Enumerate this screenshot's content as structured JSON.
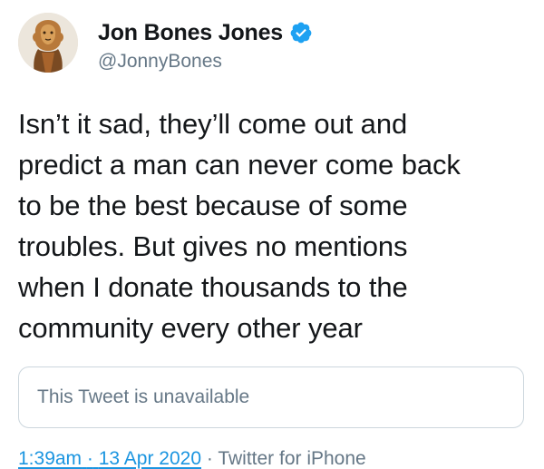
{
  "user": {
    "display_name": "Jon Bones Jones",
    "handle": "@JonnyBones",
    "verified": true
  },
  "tweet": {
    "lines": [
      "Isn’t it sad, they’ll come out and",
      "predict a man can never come back",
      "to be the best because of some",
      "troubles. But gives no mentions",
      "when I donate thousands to the",
      "community every other year"
    ],
    "quoted_tweet": "This Tweet is unavailable",
    "time": "1:39am",
    "date_sep": "·",
    "date": "13 Apr 2020",
    "source_sep": "·",
    "source": "Twitter for iPhone"
  },
  "colors": {
    "link": "#1b95e0",
    "verified_badge": "#1da1f2",
    "secondary_text": "#657786",
    "border": "#ccd6dd"
  },
  "icons": {
    "verified": "verified-badge-icon",
    "avatar": "profile-avatar"
  }
}
